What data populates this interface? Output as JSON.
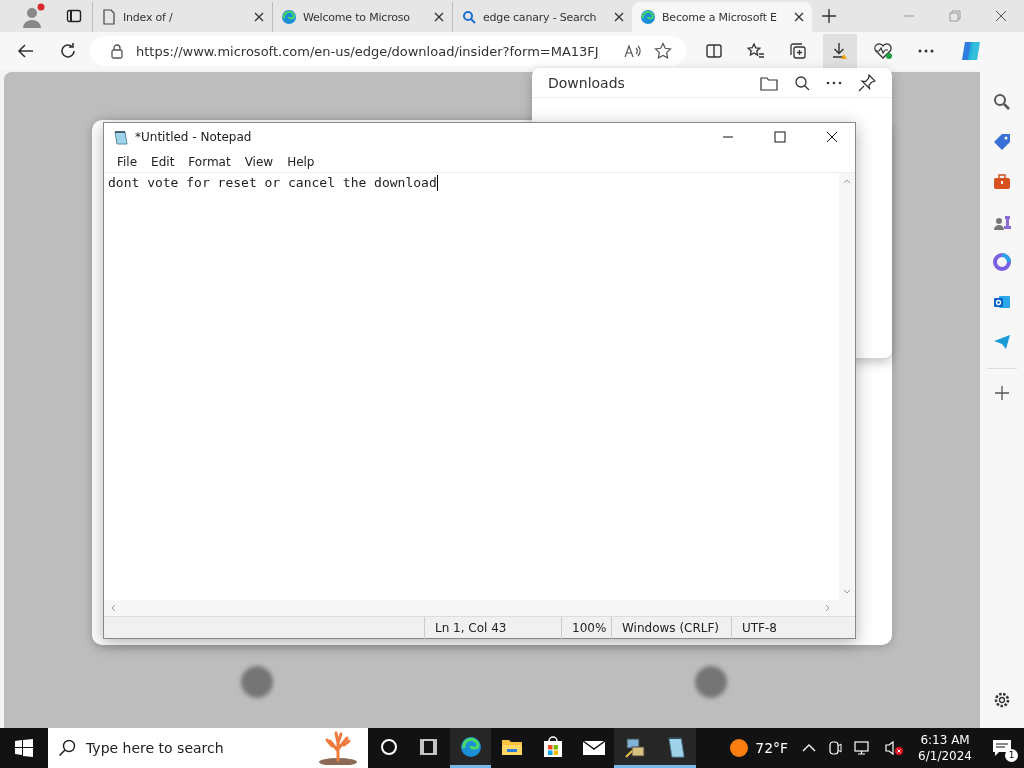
{
  "browser": {
    "tabs": [
      {
        "title": "Index of /",
        "kind": "page",
        "selected": false
      },
      {
        "title": "Welcome to Microso",
        "kind": "edge",
        "selected": false
      },
      {
        "title": "edge canary - Search",
        "kind": "search",
        "selected": false
      },
      {
        "title": "Become a Microsoft E",
        "kind": "edge",
        "selected": true
      }
    ],
    "address": "https://www.microsoft.com/en-us/edge/download/insider?form=MA13FJ",
    "downloads_panel": {
      "title": "Downloads"
    }
  },
  "notepad": {
    "title": "*Untitled - Notepad",
    "menu": [
      "File",
      "Edit",
      "Format",
      "View",
      "Help"
    ],
    "text": "dont vote for reset or cancel the download",
    "status": [
      "Ln 1, Col 43",
      "100%",
      "Windows (CRLF)",
      "UTF-8"
    ]
  },
  "taskbar": {
    "search_placeholder": "Type here to search",
    "apps": [
      {
        "kind": "cortana",
        "running": false
      },
      {
        "kind": "taskview",
        "running": false
      },
      {
        "kind": "edge",
        "running": true
      },
      {
        "kind": "folder",
        "running": false
      },
      {
        "kind": "store",
        "running": false
      },
      {
        "kind": "mail",
        "running": false
      },
      {
        "kind": "network",
        "running": true
      },
      {
        "kind": "notepad",
        "running": true
      }
    ],
    "weather": "72°F",
    "time": "6:13 AM",
    "date": "6/1/2024",
    "notifications": "1"
  }
}
